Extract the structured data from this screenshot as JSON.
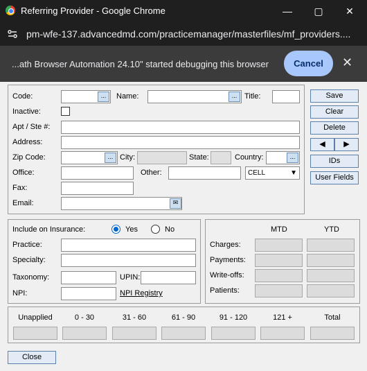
{
  "window": {
    "title": "Referring Provider - Google Chrome"
  },
  "browser": {
    "url": "pm-wfe-137.advancedmd.com/practicemanager/masterfiles/mf_providers....",
    "debug_message": "...ath Browser Automation 24.10\" started debugging this browser",
    "cancel_label": "Cancel"
  },
  "form": {
    "code_label": "Code:",
    "name_label": "Name:",
    "title_label": "Title:",
    "inactive_label": "Inactive:",
    "apt_label": "Apt / Ste #:",
    "address_label": "Address:",
    "zip_label": "Zip Code:",
    "city_label": "City:",
    "state_label": "State:",
    "country_label": "Country:",
    "office_label": "Office:",
    "other_label": "Other:",
    "other_type": "CELL",
    "fax_label": "Fax:",
    "email_label": "Email:"
  },
  "actions": {
    "save": "Save",
    "clear": "Clear",
    "delete": "Delete",
    "prev": "◀",
    "next": "▶",
    "ids": "IDs",
    "user_fields": "User Fields"
  },
  "insurance": {
    "include_label": "Include on Insurance:",
    "yes_label": "Yes",
    "no_label": "No",
    "selected": "Yes",
    "practice_label": "Practice:",
    "specialty_label": "Specialty:",
    "taxonomy_label": "Taxonomy:",
    "upin_label": "UPIN:",
    "npi_label": "NPI:",
    "npi_registry_link": "NPI Registry"
  },
  "stats": {
    "mtd_header": "MTD",
    "ytd_header": "YTD",
    "rows": [
      "Charges:",
      "Payments:",
      "Write-offs:",
      "Patients:"
    ]
  },
  "aging": {
    "headers": [
      "Unapplied",
      "0 - 30",
      "31 - 60",
      "61 - 90",
      "91 - 120",
      "121 +",
      "Total"
    ]
  },
  "footer": {
    "close_label": "Close"
  }
}
